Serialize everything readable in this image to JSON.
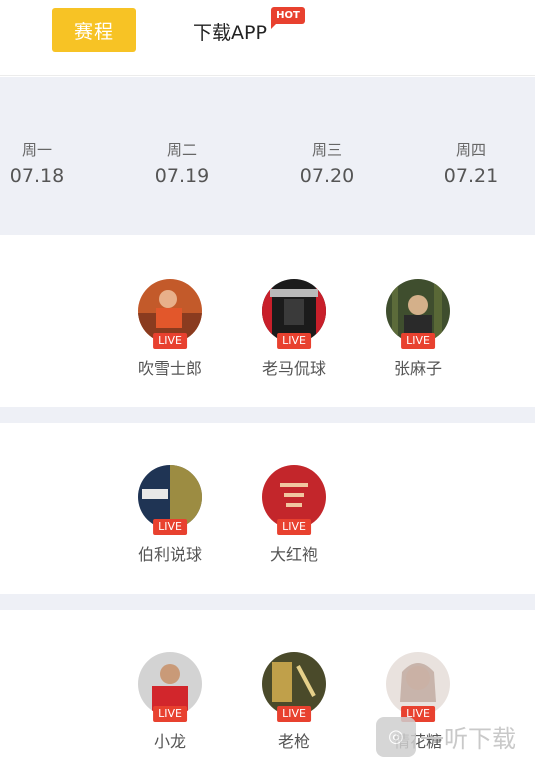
{
  "header": {
    "tab_schedule": "赛程",
    "tab_download": "下载APP",
    "hot_badge": "HOT"
  },
  "dates": [
    {
      "weekday": "周一",
      "date": "07.18"
    },
    {
      "weekday": "周二",
      "date": "07.19"
    },
    {
      "weekday": "周三",
      "date": "07.20"
    },
    {
      "weekday": "周四",
      "date": "07.21"
    }
  ],
  "live_label": "LIVE",
  "rows": [
    [
      {
        "name": "吹雪士郎"
      },
      {
        "name": "老马侃球"
      },
      {
        "name": "张麻子"
      }
    ],
    [
      {
        "name": "伯利说球"
      },
      {
        "name": "大红袍"
      }
    ],
    [
      {
        "name": "小龙"
      },
      {
        "name": "老枪"
      },
      {
        "name": "情花糖"
      }
    ]
  ],
  "watermark": {
    "text": "一听下载"
  }
}
